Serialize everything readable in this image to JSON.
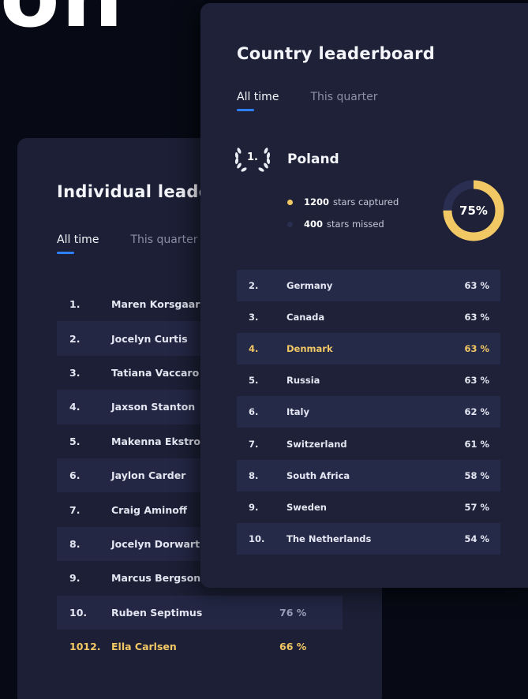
{
  "hero_fragment": "on",
  "individual": {
    "title": "Individual leaderboard",
    "tabs": [
      {
        "label": "All time",
        "active": true
      },
      {
        "label": "This quarter",
        "active": false
      }
    ],
    "rows": [
      {
        "rank": "1.",
        "name": "Maren Korsgaard",
        "pct": ""
      },
      {
        "rank": "2.",
        "name": "Jocelyn Curtis",
        "pct": ""
      },
      {
        "rank": "3.",
        "name": "Tatiana Vaccaro",
        "pct": ""
      },
      {
        "rank": "4.",
        "name": "Jaxson Stanton",
        "pct": ""
      },
      {
        "rank": "5.",
        "name": "Makenna Ekstrom",
        "pct": ""
      },
      {
        "rank": "6.",
        "name": "Jaylon Carder",
        "pct": ""
      },
      {
        "rank": "7.",
        "name": "Craig Aminoff",
        "pct": ""
      },
      {
        "rank": "8.",
        "name": "Jocelyn Dorwart",
        "pct": ""
      },
      {
        "rank": "9.",
        "name": "Marcus Bergson",
        "pct": ""
      },
      {
        "rank": "10.",
        "name": "Ruben Septimus",
        "pct": "76 %"
      },
      {
        "rank": "1012.",
        "name": "Ella Carlsen",
        "pct": "66 %",
        "highlight": true
      }
    ]
  },
  "country": {
    "title": "Country leaderboard",
    "tabs": [
      {
        "label": "All time",
        "active": true
      },
      {
        "label": "This quarter",
        "active": false
      }
    ],
    "winner": {
      "rank": "1.",
      "name": "Poland",
      "captured_value": "1200",
      "captured_label": "stars captured",
      "missed_value": "400",
      "missed_label": "stars missed",
      "percent_label": "75%",
      "percent_fraction": 0.75
    },
    "rows": [
      {
        "rank": "2.",
        "name": "Germany",
        "pct": "63 %"
      },
      {
        "rank": "3.",
        "name": "Canada",
        "pct": "63 %"
      },
      {
        "rank": "4.",
        "name": "Denmark",
        "pct": "63 %",
        "highlight": true
      },
      {
        "rank": "5.",
        "name": "Russia",
        "pct": "63 %"
      },
      {
        "rank": "6.",
        "name": "Italy",
        "pct": "62 %"
      },
      {
        "rank": "7.",
        "name": "Switzerland",
        "pct": "61 %"
      },
      {
        "rank": "8.",
        "name": "South Africa",
        "pct": "58 %"
      },
      {
        "rank": "9.",
        "name": "Sweden",
        "pct": "57 %"
      },
      {
        "rank": "10.",
        "name": "The Netherlands",
        "pct": "54 %"
      }
    ]
  },
  "colors": {
    "accent": "#2f80ff",
    "highlight": "#f2c865",
    "donut_track": "#2a2f52",
    "captured_dot": "#f2c865",
    "missed_dot": "#2a2f52"
  },
  "icons": {
    "laurel": "laurel-wreath-icon"
  }
}
